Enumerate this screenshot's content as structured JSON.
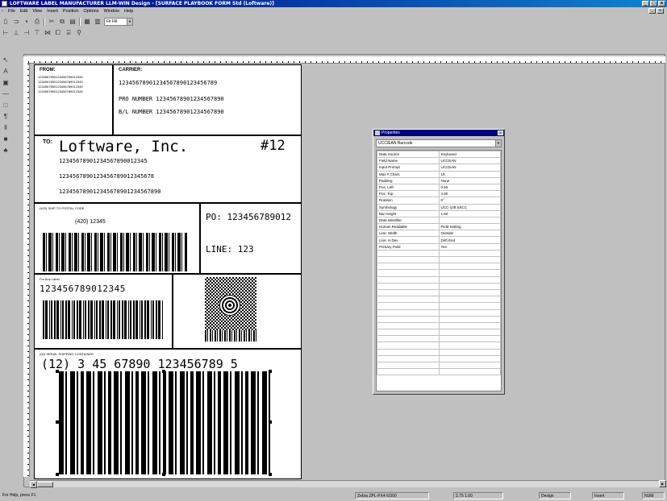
{
  "window": {
    "title": "LOFTWARE LABEL MANUFACTURER LLM-WIN Design - [SURFACE PLAYBOOK FORM Std (Loftware)]",
    "controls": [
      "_",
      "□",
      "x"
    ]
  },
  "menu": [
    "File",
    "Edit",
    "View",
    "Insert",
    "Position",
    "Options",
    "Window",
    "Help"
  ],
  "toolbar": {
    "zoom_value": "Fit Fill"
  },
  "label": {
    "from_heading": "FROM:",
    "from_lines": [
      "1234567890123456789012345",
      "1234567890123456789012345",
      "1234567890123456789012345",
      "1234567890123456789012345"
    ],
    "carrier_heading": "CARRIER:",
    "carrier_number": "12345678901234567890123456789",
    "pro_number": "PRO NUMBER 12345678901234567890",
    "bl_number": "B/L NUMBER 12345678901234567890",
    "to_heading": "TO:",
    "to_company": "Loftware, Inc.",
    "to_number": "#12",
    "to_lines": [
      "12345678901234567890012345",
      "1234567890123456789012345678",
      "123456789012345678901234567890"
    ],
    "postal_caption": "(420) SHIP TO POSTAL CODE",
    "postal_value": "(420) 12345",
    "po_value": "PO: 123456789012",
    "line_value": "LINE: 123",
    "forany_caption": "For Any Label",
    "forany_value": "123456789012345",
    "sscc_caption": "(00) SERIAL SHIPPING CONTAINER",
    "sscc_value": "(12) 3 45 67890 123456789 5"
  },
  "properties": {
    "title": "Properties",
    "selected_object": "UCC/EAN Barcode",
    "rows": [
      [
        "Data Source",
        "Keyboard"
      ],
      [
        "Field Name",
        "UCCEAN"
      ],
      [
        "Input Prompt",
        "UCCEAN"
      ],
      [
        "Max # Chars",
        "19"
      ],
      [
        "Padding",
        "None"
      ],
      [
        "Pos. Left",
        "0.50"
      ],
      [
        "Pos. Top",
        "4.80"
      ],
      [
        "Rotation",
        "0°"
      ],
      [
        "Symbology",
        "UCC-128 SSCC"
      ],
      [
        "Bar Height",
        "1.60"
      ],
      [
        "Data Identifier",
        ""
      ],
      [
        "Human Readable",
        "Field Setting"
      ],
      [
        "Line: Width",
        "Outside"
      ],
      [
        "Line: H.Dev",
        "Drift End"
      ],
      [
        "Primary Field",
        "Yes"
      ],
      [
        "",
        ""
      ],
      [
        "",
        ""
      ],
      [
        "",
        ""
      ],
      [
        "",
        ""
      ],
      [
        "",
        ""
      ],
      [
        "",
        ""
      ],
      [
        "",
        ""
      ],
      [
        "",
        ""
      ],
      [
        "",
        ""
      ],
      [
        "",
        ""
      ],
      [
        "",
        ""
      ],
      [
        "",
        ""
      ],
      [
        "",
        ""
      ],
      [
        "",
        ""
      ],
      [
        "",
        ""
      ],
      [
        "",
        ""
      ],
      [
        "",
        ""
      ],
      [
        "",
        ""
      ],
      [
        "",
        ""
      ]
    ]
  },
  "status": {
    "help": "For Help, press F1",
    "printer": "Zebra ZPL-PX4 6/300",
    "coords": "2.75 1.00",
    "mode": "Design",
    "field": "Insert",
    "state": "NUM"
  }
}
